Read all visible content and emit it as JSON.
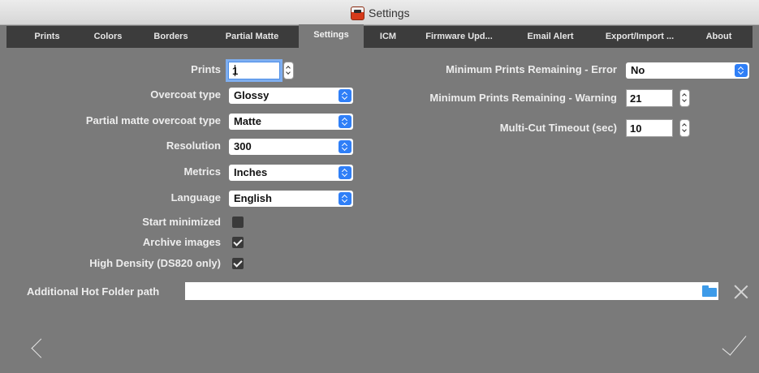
{
  "window": {
    "title": "Settings",
    "app_icon": "printer-app-icon"
  },
  "tabs": [
    {
      "label": "Prints"
    },
    {
      "label": "Colors"
    },
    {
      "label": "Borders"
    },
    {
      "label": "Partial Matte"
    },
    {
      "label": "Settings",
      "active": true
    },
    {
      "label": "ICM"
    },
    {
      "label": "Firmware Upd..."
    },
    {
      "label": "Email Alert"
    },
    {
      "label": "Export/Import ..."
    },
    {
      "label": "About"
    }
  ],
  "left": {
    "prints": {
      "label": "Prints",
      "value": "1"
    },
    "overcoat": {
      "label": "Overcoat type",
      "value": "Glossy"
    },
    "partial_matte": {
      "label": "Partial matte overcoat type",
      "value": "Matte"
    },
    "resolution": {
      "label": "Resolution",
      "value": "300"
    },
    "metrics": {
      "label": "Metrics",
      "value": "Inches"
    },
    "language": {
      "label": "Language",
      "value": "English"
    },
    "start_minimized": {
      "label": "Start minimized",
      "checked": false
    },
    "archive_images": {
      "label": "Archive images",
      "checked": true
    },
    "high_density": {
      "label": "High Density (DS820 only)",
      "checked": true
    }
  },
  "right": {
    "min_error": {
      "label": "Minimum Prints Remaining - Error",
      "value": "No"
    },
    "min_warning": {
      "label": "Minimum Prints Remaining - Warning",
      "value": "21"
    },
    "multicut": {
      "label": "Multi-Cut Timeout (sec)",
      "value": "10"
    }
  },
  "hot_folder": {
    "label": "Additional Hot Folder path",
    "value": ""
  },
  "colors": {
    "accent": "#2f7ff7",
    "tabbar": "#3c3c3c",
    "panel": "#7a7a7a",
    "folder": "#3d9be9"
  }
}
